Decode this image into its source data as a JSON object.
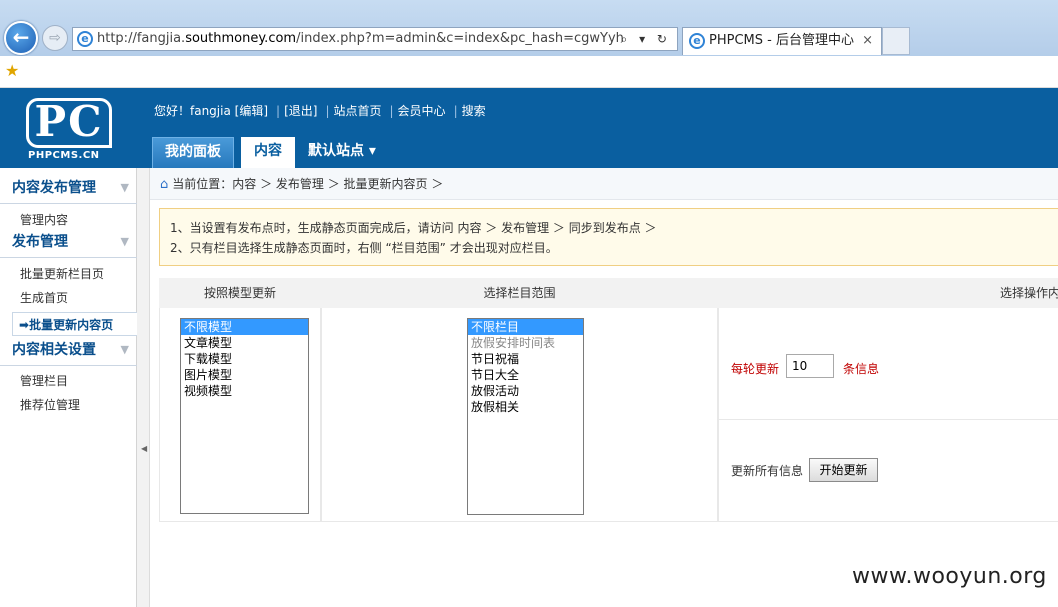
{
  "browser": {
    "url_prefix": "http://fangjia.",
    "url_domain": "southmoney.com",
    "url_suffix": "/index.php?m=admin&c=index&pc_hash=cgwYyh",
    "tab_title": "PHPCMS - 后台管理中心",
    "back_glyph": "←",
    "forward_glyph": "⇨",
    "tab_close": "×",
    "addr_tools": "⌕ ▾ ↻",
    "ie_glyph": "e",
    "fav_glyph": "★"
  },
  "header": {
    "logo_mark": "PC",
    "logo_text": "PHPCMS.CN",
    "greeting": "您好！fangjia [编辑]",
    "logout": "[退出]",
    "site_home": "站点首页",
    "member_center": "会员中心",
    "search": "搜索",
    "tabs": {
      "panel": "我的面板",
      "content": "内容",
      "site": "默认站点 ▾"
    }
  },
  "sidebar": {
    "sections": [
      {
        "title": "内容发布管理",
        "items": [
          "管理内容"
        ]
      },
      {
        "title": "发布管理",
        "items": [
          "批量更新栏目页",
          "生成首页",
          "批量更新内容页"
        ]
      },
      {
        "title": "内容相关设置",
        "items": [
          "管理栏目",
          "推荐位管理"
        ]
      }
    ],
    "active_item": "批量更新内容页",
    "chevron": "▼",
    "active_marker": "➡"
  },
  "breadcrumb": {
    "home_glyph": "⌂",
    "text": "当前位置：内容 ＞ 发布管理 ＞ 批量更新内容页 ＞"
  },
  "notice": {
    "line1": "1、当设置有发布点时，生成静态页面完成后，请访问 内容 ＞ 发布管理 ＞ 同步到发布点 ＞",
    "line2": "2、只有栏目选择生成静态页面时，右侧 “栏目范围” 才会出现对应栏目。"
  },
  "columns": {
    "model": "按照模型更新",
    "category": "选择栏目范围",
    "operation": "选择操作内容"
  },
  "model_options": [
    "不限模型",
    "文章模型",
    "下载模型",
    "图片模型",
    "视频模型"
  ],
  "category_options": [
    "不限栏目",
    "放假安排时间表",
    "节日祝福",
    "节日大全",
    "放假活动",
    "放假相关"
  ],
  "operation": {
    "each_label": "每轮更新",
    "each_value": "10",
    "each_unit": "条信息",
    "all_label": "更新所有信息",
    "start_button": "开始更新"
  },
  "watermark": "www.wooyun.org",
  "split_glyph": "◀"
}
